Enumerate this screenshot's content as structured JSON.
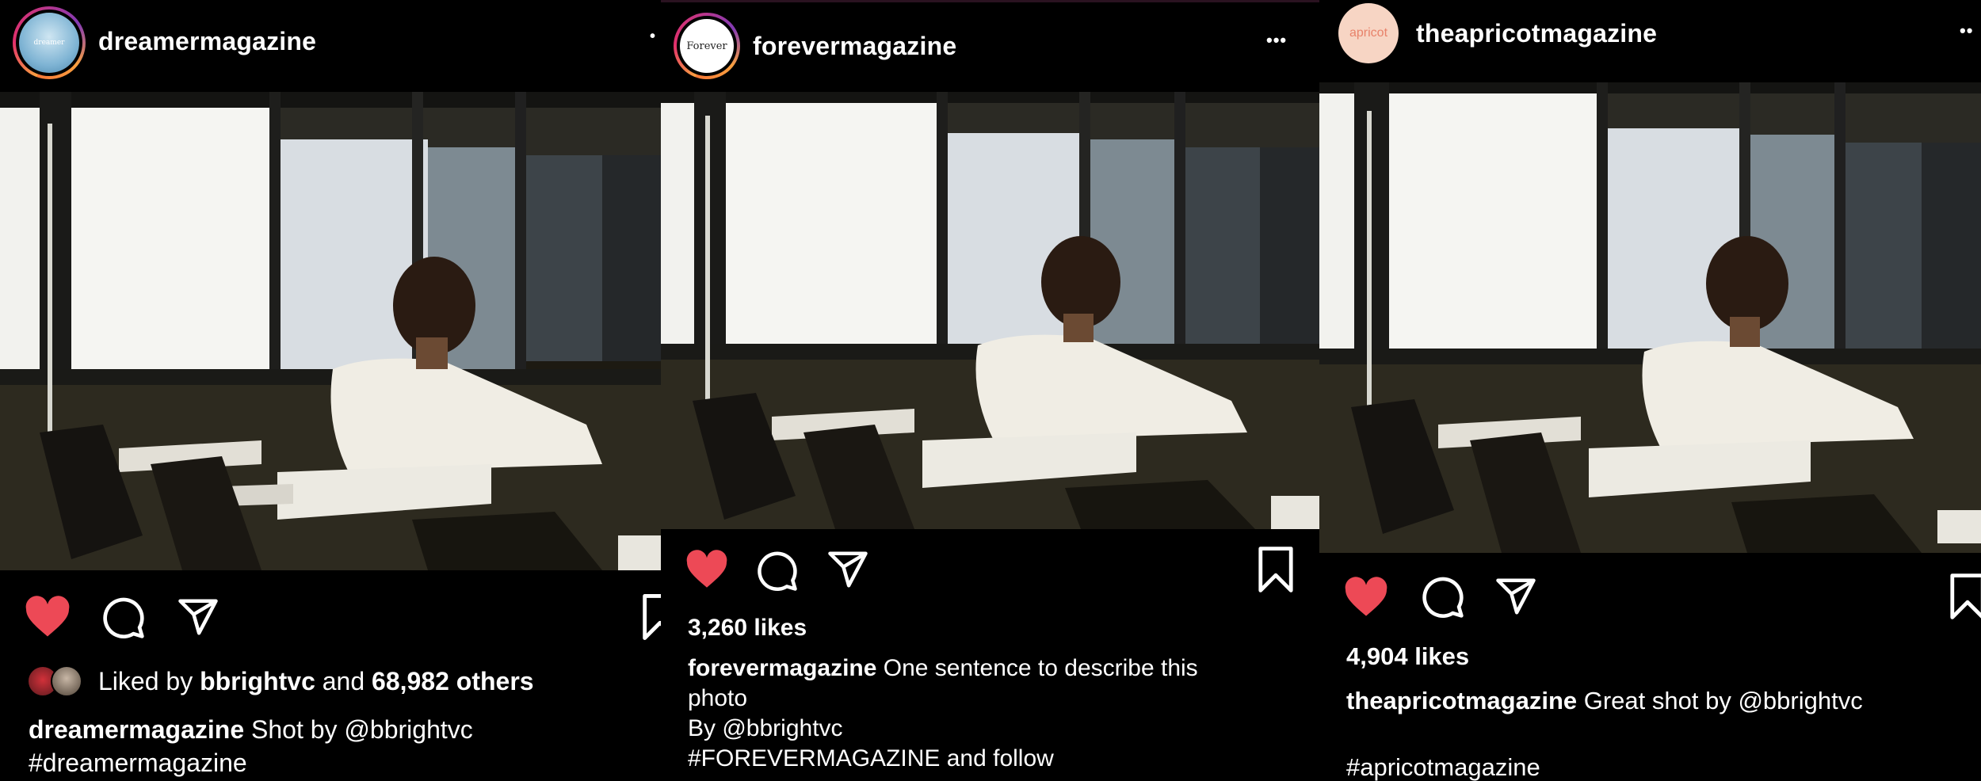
{
  "posts": [
    {
      "username": "dreamermagazine",
      "avatar_text": "dreamer",
      "more_label": "•",
      "liked_by_prefix": "Liked by ",
      "liked_by_user": "bbrightvc",
      "liked_by_mid": " and ",
      "liked_by_others": "68,982 others",
      "caption_user": "dreamermagazine",
      "caption_text": " Shot by @bbrightvc",
      "caption_line2": "#dreamermagazine"
    },
    {
      "username": "forevermagazine",
      "avatar_text": "Forever",
      "more_label": "•••",
      "likes": "3,260 likes",
      "caption_user": "forevermagazine",
      "caption_text": " One sentence to describe this",
      "caption_line2": "photo",
      "caption_line3": "By @bbrightvc",
      "caption_line4": "#FOREVERMAGAZINE and follow"
    },
    {
      "username": "theapricotmagazine",
      "avatar_text": "apricot",
      "more_label": "••",
      "likes": "4,904 likes",
      "caption_user": "theapricotmagazine",
      "caption_text": " Great shot by @bbrightvc",
      "caption_line3": "#apricotmagazine"
    }
  ],
  "colors": {
    "like_red": "#ed4956",
    "apricot_avatar_bg": "#f7d5c4",
    "apricot_avatar_text": "#e8826a"
  },
  "icons": [
    "heart-filled-icon",
    "comment-icon",
    "share-icon",
    "bookmark-icon",
    "more-icon"
  ]
}
